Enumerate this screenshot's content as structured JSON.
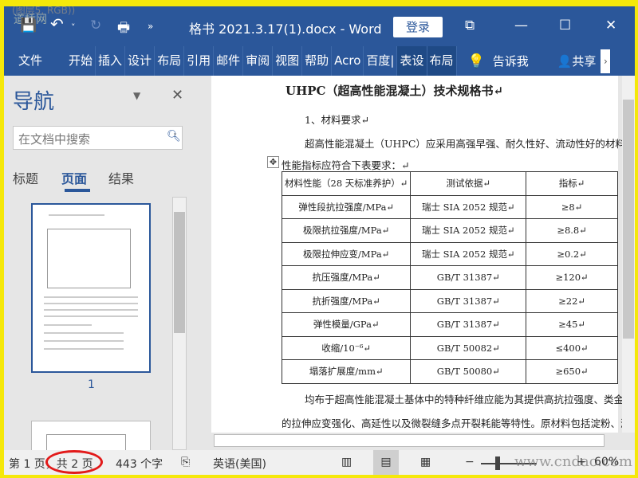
{
  "window": {
    "title": "格书 2021.3.17(1).docx  -  Word",
    "login": "登录",
    "watermark_top": "(图层5, RGB))",
    "watermark_logo": "道桥网"
  },
  "quick_access": {
    "save": "💾",
    "undo": "↶",
    "undo_dd": "˅",
    "redo": "↻",
    "print": "🖶",
    "more": "»"
  },
  "controls": {
    "restore": "⧉",
    "minimize": "—",
    "maximize": "☐",
    "close": "✕"
  },
  "ribbon": {
    "tabs": [
      "文件",
      "开始",
      "插入",
      "设计",
      "布局",
      "引用",
      "邮件",
      "审阅",
      "视图",
      "帮助",
      "Acro",
      "百度|",
      "表设",
      "布局"
    ],
    "tell_me": "告诉我",
    "share": "共享",
    "scroll": "›"
  },
  "nav": {
    "title": "导航",
    "search_placeholder": "在文档中搜索",
    "tabs": [
      "标题",
      "页面",
      "结果"
    ],
    "page1": "1"
  },
  "doc": {
    "title": "UHPC（超高性能混凝土）技术规格书↵",
    "heading1": "1、材料要求↵",
    "para1a": "超高性能混凝土（UHPC）应采用高强早强、耐久性好、流动性好的材料，其",
    "para1b": "性能指标应符合下表要求：↵",
    "table": {
      "headers": [
        "材料性能（28 天标准养护）↵",
        "测试依据↵",
        "指标↵"
      ],
      "rows": [
        [
          "弹性段抗拉强度/MPa↵",
          "瑞士 SIA 2052 规范↵",
          "≥8↵"
        ],
        [
          "极限抗拉强度/MPa↵",
          "瑞士 SIA 2052 规范↵",
          "≥8.8↵"
        ],
        [
          "极限拉伸应变/MPa↵",
          "瑞士 SIA 2052 规范↵",
          "≥0.2↵"
        ],
        [
          "抗压强度/MPa↵",
          "GB/T 31387↵",
          "≥120↵"
        ],
        [
          "抗折强度/MPa↵",
          "GB/T 31387↵",
          "≥22↵"
        ],
        [
          "弹性模量/GPa↵",
          "GB/T 31387↵",
          "≥45↵"
        ],
        [
          "收缩/10⁻⁶↵",
          "GB/T 50082↵",
          "≤400↵"
        ],
        [
          "塌落扩展度/mm↵",
          "GB/T 50080↵",
          "≥650↵"
        ]
      ]
    },
    "para2a": "均布于超高性能混凝土基体中的特种纤维应能为其提供高抗拉强度、类金属",
    "para2b": "的拉伸应变强化、高延性以及微裂缝多点开裂耗能等特性。原材料包括淀粉、液"
  },
  "status": {
    "page": "第 1 页，共 2 页",
    "words": "443 个字",
    "language": "英语(美国)",
    "zoom": "60%",
    "zoom_minus": "−",
    "zoom_plus": "+",
    "watermark": "www.cndao.com"
  }
}
